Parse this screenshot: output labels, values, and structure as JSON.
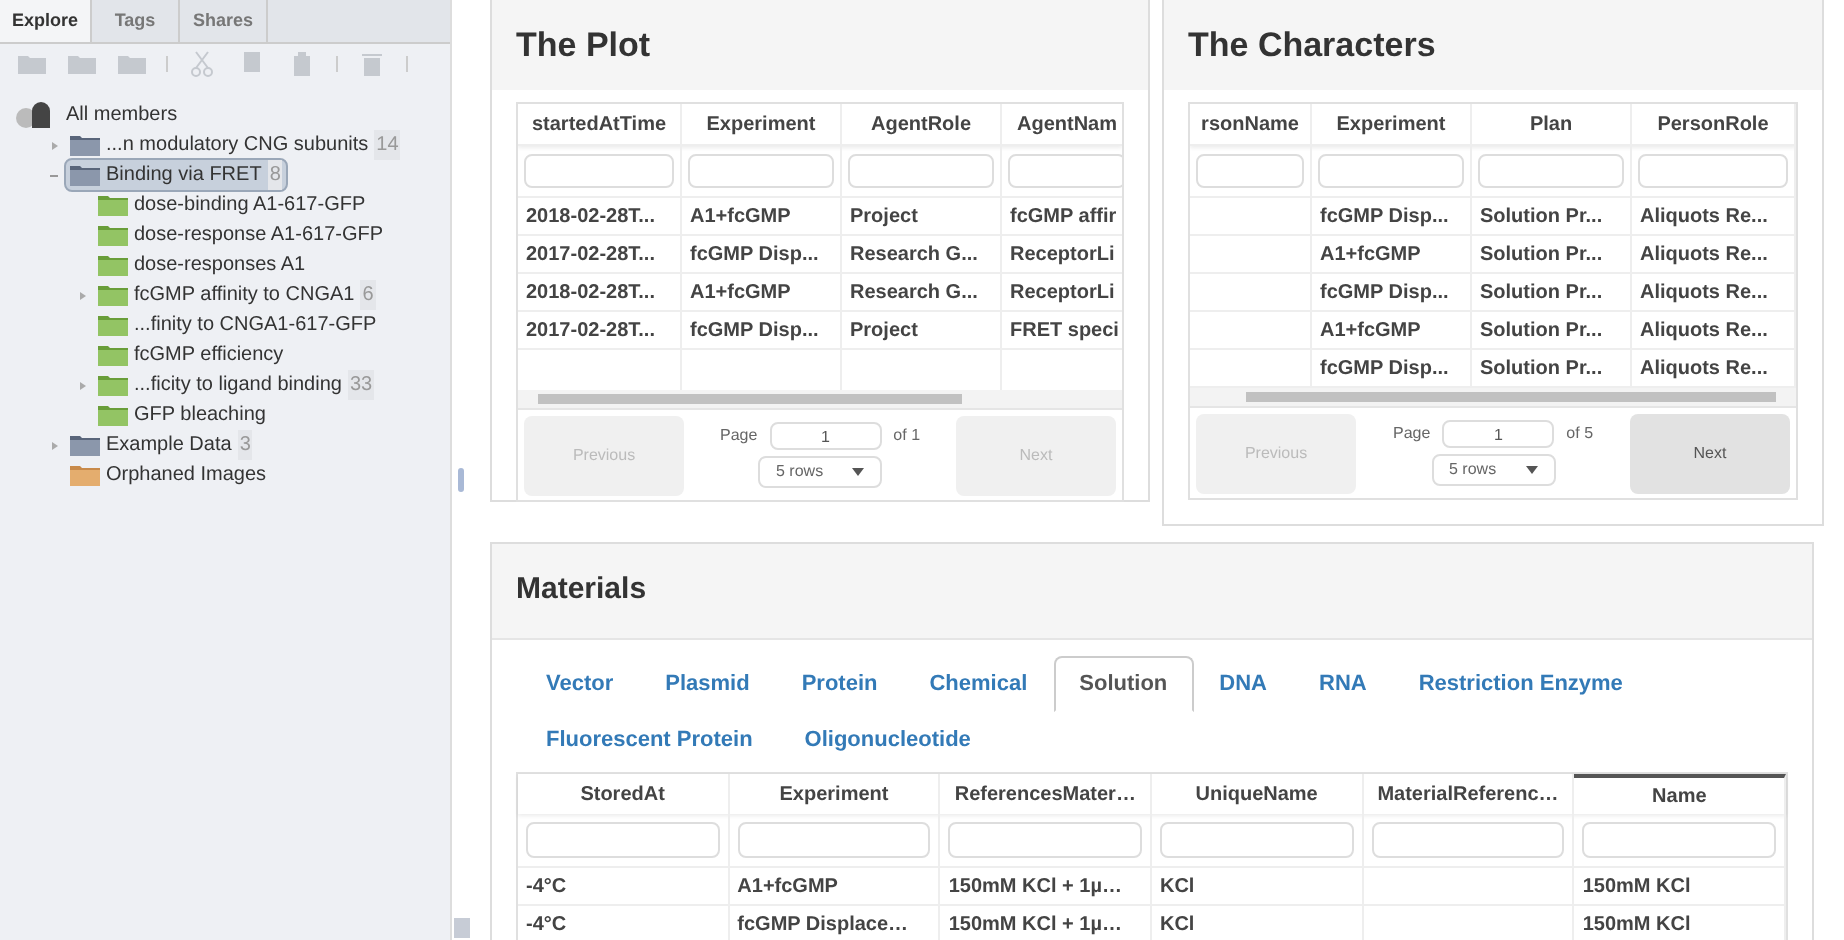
{
  "sidebar": {
    "tabs": [
      {
        "label": "Explore",
        "selected": true
      },
      {
        "label": "Tags",
        "selected": false
      },
      {
        "label": "Shares",
        "selected": false
      }
    ],
    "toolbar": [
      {
        "kind": "folder",
        "disabled": true
      },
      {
        "kind": "folder",
        "disabled": true
      },
      {
        "kind": "folder",
        "disabled": true
      },
      {
        "kind": "sep"
      },
      {
        "kind": "cut",
        "disabled": true
      },
      {
        "kind": "copy",
        "disabled": true
      },
      {
        "kind": "paste",
        "disabled": true
      },
      {
        "kind": "sep"
      },
      {
        "kind": "trash",
        "disabled": true
      },
      {
        "kind": "sep"
      }
    ],
    "tree": {
      "label": "All members",
      "children": [
        {
          "kind": "project",
          "label": "...n modulatory CNG subunits",
          "count": "14",
          "expanded": false,
          "selected": false
        },
        {
          "kind": "project",
          "label": "Binding via FRET",
          "count": "8",
          "expanded": true,
          "selected": true,
          "children": [
            {
              "kind": "dataset",
              "label": "dose-binding A1-617-GFP",
              "selected": false
            },
            {
              "kind": "dataset",
              "label": "dose-response A1-617-GFP",
              "selected": false
            },
            {
              "kind": "dataset",
              "label": "dose-responses A1",
              "selected": false
            },
            {
              "kind": "dataset",
              "label": "fcGMP affinity to CNGA1",
              "count": "6",
              "expanded": false,
              "selected": false
            },
            {
              "kind": "dataset",
              "label": "...finity to CNGA1-617-GFP",
              "selected": false
            },
            {
              "kind": "dataset",
              "label": "fcGMP efficiency",
              "selected": false
            },
            {
              "kind": "dataset",
              "label": "...ficity to ligand binding",
              "count": "33",
              "expanded": false,
              "selected": false
            },
            {
              "kind": "dataset",
              "label": "GFP bleaching",
              "selected": false
            }
          ]
        },
        {
          "kind": "project",
          "label": "Example Data",
          "count": "3",
          "expanded": false,
          "selected": false
        },
        {
          "kind": "orphan",
          "label": "Orphaned Images",
          "selected": false
        }
      ]
    }
  },
  "plot": {
    "title": "The Plot",
    "columns": [
      "startedAtTime",
      "Experiment",
      "AgentRole",
      "AgentNam"
    ],
    "rows": [
      [
        "2018-02-28T...",
        "A1+fcGMP",
        "Project",
        "fcGMP affir"
      ],
      [
        "2017-02-28T...",
        "fcGMP Disp...",
        "Research G...",
        "ReceptorLi"
      ],
      [
        "2018-02-28T...",
        "A1+fcGMP",
        "Research G...",
        "ReceptorLi"
      ],
      [
        "2017-02-28T...",
        "fcGMP Disp...",
        "Project",
        "FRET speci"
      ]
    ],
    "pager": {
      "previous": "Previous",
      "previous_disabled": true,
      "page_label": "Page",
      "page": "1",
      "of": "of 1",
      "rows": "5 rows",
      "next": "Next",
      "next_disabled": true
    }
  },
  "characters": {
    "title": "The Characters",
    "columns": [
      "rsonName",
      "Experiment",
      "Plan",
      "PersonRole"
    ],
    "rows": [
      [
        "",
        "fcGMP Disp...",
        "Solution Pr...",
        "Aliquots Re..."
      ],
      [
        "",
        "A1+fcGMP",
        "Solution Pr...",
        "Aliquots Re..."
      ],
      [
        "",
        "fcGMP Disp...",
        "Solution Pr...",
        "Aliquots Re..."
      ],
      [
        "",
        "A1+fcGMP",
        "Solution Pr...",
        "Aliquots Re..."
      ],
      [
        "",
        "fcGMP Disp...",
        "Solution Pr...",
        "Aliquots Re..."
      ]
    ],
    "pager": {
      "previous": "Previous",
      "previous_disabled": true,
      "page_label": "Page",
      "page": "1",
      "of": "of 5",
      "rows": "5 rows",
      "next": "Next",
      "next_disabled": false
    }
  },
  "materials": {
    "title": "Materials",
    "tabs": [
      {
        "label": "Vector",
        "selected": false
      },
      {
        "label": "Plasmid",
        "selected": false
      },
      {
        "label": "Protein",
        "selected": false
      },
      {
        "label": "Chemical",
        "selected": false
      },
      {
        "label": "Solution",
        "selected": true
      },
      {
        "label": "DNA",
        "selected": false
      },
      {
        "label": "RNA",
        "selected": false
      },
      {
        "label": "Restriction Enzyme",
        "selected": false
      },
      {
        "label": "Fluorescent Protein",
        "selected": false
      },
      {
        "label": "Oligonucleotide",
        "selected": false
      }
    ],
    "columns": [
      {
        "label": "StoredAt",
        "sorted": false
      },
      {
        "label": "Experiment",
        "sorted": false
      },
      {
        "label": "ReferencesMater…",
        "sorted": false
      },
      {
        "label": "UniqueName",
        "sorted": false
      },
      {
        "label": "MaterialReferenc…",
        "sorted": false
      },
      {
        "label": "Name",
        "sorted": true
      }
    ],
    "rows": [
      [
        "-4°C",
        "A1+fcGMP",
        "150mM KCl + 1µ…",
        "KCl",
        "",
        "150mM KCl"
      ],
      [
        "-4°C",
        "fcGMP Displace…",
        "150mM KCl + 1µ…",
        "KCl",
        "",
        "150mM KCl"
      ]
    ]
  }
}
